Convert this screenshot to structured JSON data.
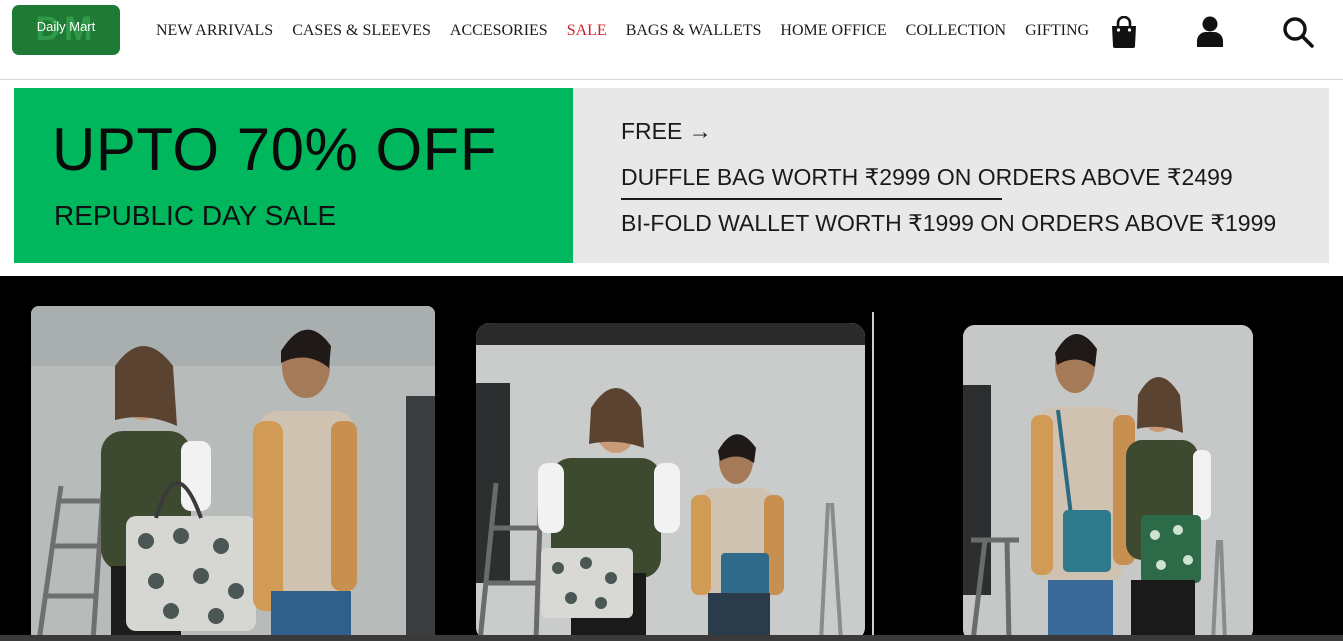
{
  "brand": {
    "monogram": "DM",
    "name": "Daily Mart",
    "color": "#1e7a35"
  },
  "nav": {
    "items": [
      {
        "label": "NEW ARRIVALS"
      },
      {
        "label": "CASES & SLEEVES"
      },
      {
        "label": "ACCESORIES"
      },
      {
        "label": "SALE",
        "highlight_color": "#d0212a"
      },
      {
        "label": "BAGS & WALLETS"
      },
      {
        "label": "HOME OFFICE"
      },
      {
        "label": "COLLECTION"
      },
      {
        "label": "GIFTING"
      }
    ]
  },
  "header_icons": [
    "shopping-bag-icon",
    "user-icon",
    "search-icon"
  ],
  "banner": {
    "headline": "UPTO 70% OFF",
    "subheadline": "REPUBLIC DAY SALE",
    "free_label": "FREE →",
    "offers": [
      "DUFFLE BAG WORTH ₹2999 ON ORDERS ABOVE ₹2499",
      "BI-FOLD WALLET WORTH ₹1999 ON ORDERS ABOVE ₹1999"
    ],
    "colors": {
      "left_bg": "#00b75e",
      "right_bg": "#e8e8e8"
    }
  },
  "gallery": {
    "photos": [
      {
        "subject": "two models with printed tote bag"
      },
      {
        "subject": "two models with laptop sleeves"
      },
      {
        "subject": "two models with crossbody bags"
      }
    ],
    "background": "#000000"
  }
}
